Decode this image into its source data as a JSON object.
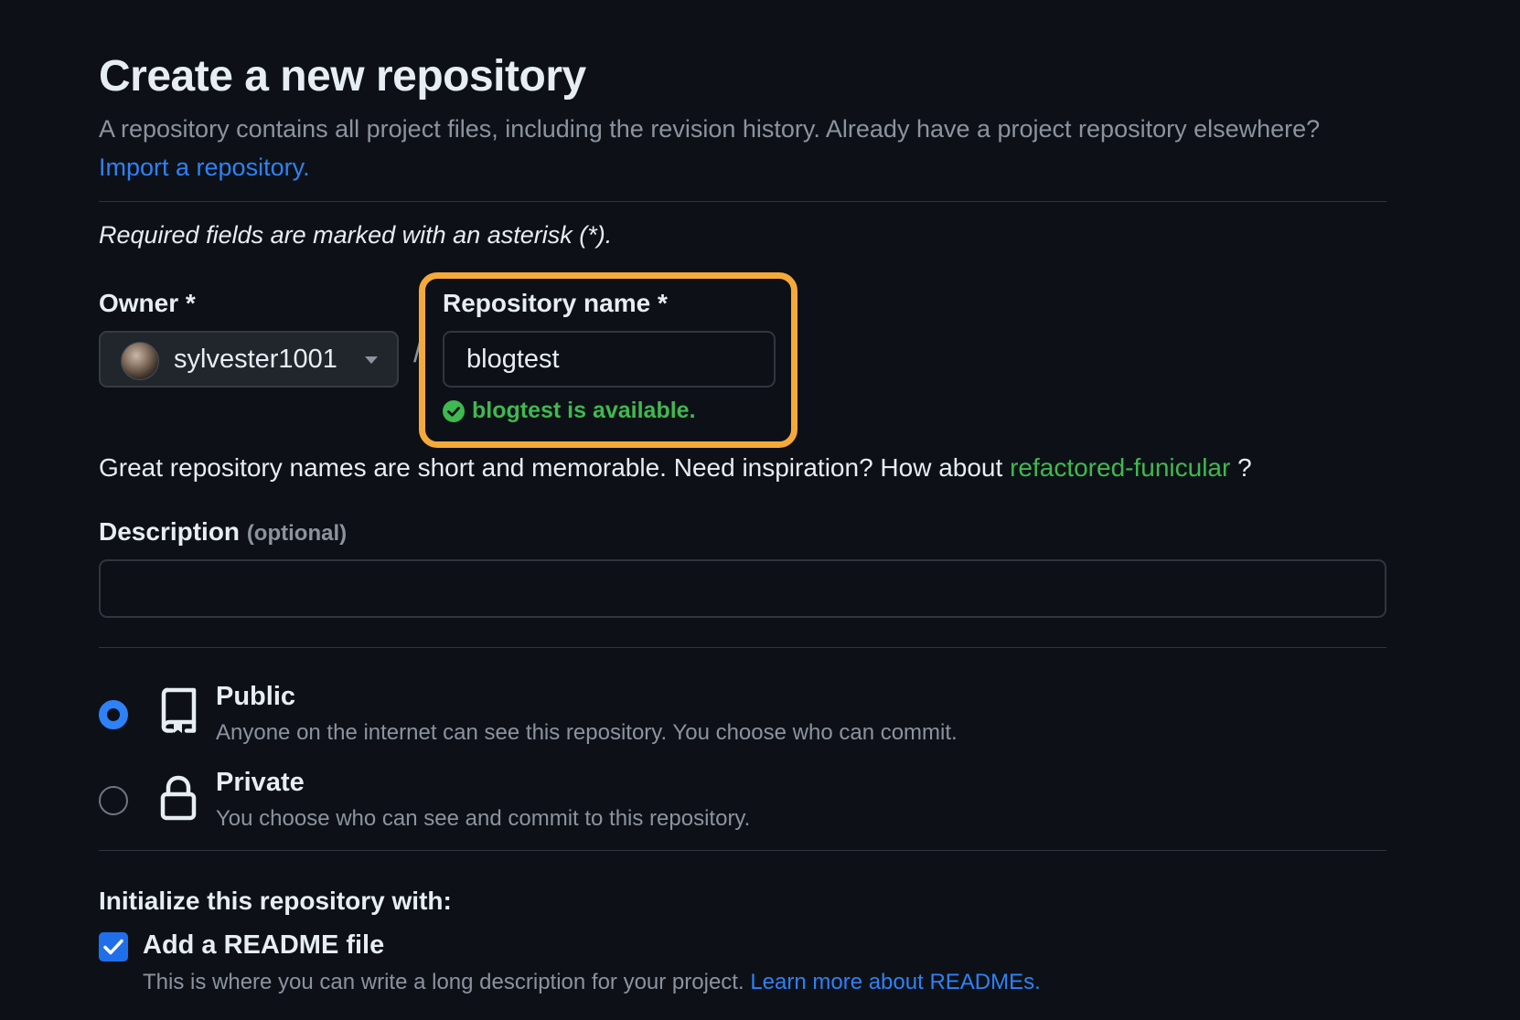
{
  "header": {
    "title": "Create a new repository",
    "subtitle": "A repository contains all project files, including the revision history. Already have a project repository elsewhere?",
    "import_link": "Import a repository."
  },
  "form": {
    "required_note": "Required fields are marked with an asterisk (*).",
    "owner": {
      "label": "Owner *",
      "value": "sylvester1001"
    },
    "separator": "/",
    "repo_name": {
      "label": "Repository name *",
      "value": "blogtest",
      "status": "blogtest is available."
    },
    "suggestion": {
      "text": "Great repository names are short and memorable. Need inspiration? How about",
      "name": "refactored-funicular",
      "suffix": "?"
    },
    "description": {
      "label": "Description",
      "optional": "(optional)",
      "value": ""
    },
    "visibility": [
      {
        "title": "Public",
        "desc": "Anyone on the internet can see this repository. You choose who can commit.",
        "selected": true
      },
      {
        "title": "Private",
        "desc": "You choose who can see and commit to this repository.",
        "selected": false
      }
    ],
    "initialize": {
      "title": "Initialize this repository with:",
      "readme": {
        "label": "Add a README file",
        "checked": true,
        "desc": "This is where you can write a long description for your project.",
        "link": "Learn more about READMEs."
      }
    }
  },
  "colors": {
    "background": "#0d1117",
    "accent_blue": "#2f81f7",
    "success_green": "#3fb950",
    "highlight_orange": "#f5a93a"
  }
}
